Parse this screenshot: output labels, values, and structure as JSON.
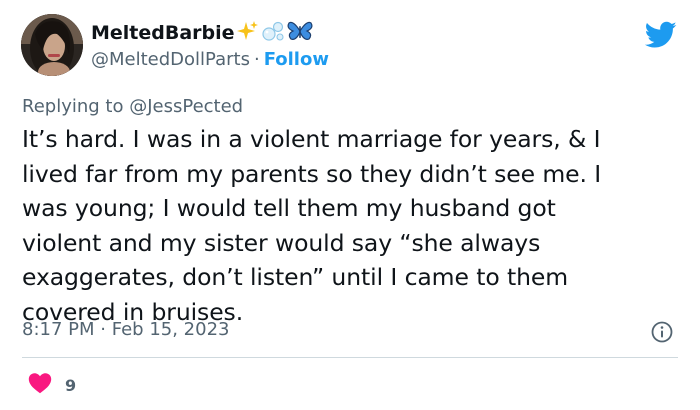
{
  "author": {
    "display_name": "MeltedBarbie",
    "name_emojis": [
      "sparkles-emoji",
      "bubbles-emoji",
      "butterfly-emoji"
    ],
    "handle": "@MeltedDollParts",
    "separator": "·",
    "follow_label": "Follow"
  },
  "reply": {
    "prefix": "Replying to",
    "handle": "@JessPected"
  },
  "tweet": {
    "text": "It’s hard. I was in a violent marriage for years, & I\nlived far from my parents so they didn’t see me. I\nwas young; I would tell them my husband got\nviolent and my sister would say “she always\nexaggerates, don’t listen” until I came to them\ncovered in bruises.",
    "time": "8:17 PM",
    "separator": "·",
    "date": "Feb 15, 2023"
  },
  "engagement": {
    "like_count": "9"
  },
  "icons": {
    "logo": "twitter-bird-icon",
    "info": "info-icon",
    "like": "heart-icon"
  },
  "colors": {
    "twitter_blue": "#1d9bf0",
    "heart_pink": "#f91880",
    "secondary_text": "#536471",
    "primary_text": "#0f1419"
  }
}
